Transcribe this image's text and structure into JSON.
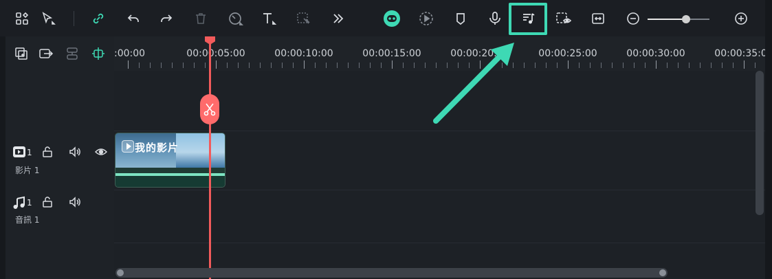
{
  "toolbar": {
    "left_tools": [
      "layout-icon",
      "select-arrow-icon",
      "link-icon",
      "undo-icon",
      "redo-icon",
      "delete-icon",
      "speed-icon",
      "text-icon",
      "crop-icon",
      "more-icon"
    ],
    "center_tools": [
      "ai-bot-icon",
      "render-preview-icon",
      "marker-icon",
      "voiceover-icon",
      "audio-beat-icon",
      "proxy-preview-icon",
      "fit-icon"
    ],
    "highlighted_tool": "audio-beat-icon",
    "zoom_level": 0.62
  },
  "timeline": {
    "ruler_labels": [
      ":00:00",
      "00:00:05:00",
      "00:00:10:00",
      "00:00:15:00",
      "00:00:20:00",
      "00:00:25:00",
      "00:00:30:00",
      "00:00:35:00"
    ],
    "playhead_time": "00:00:04:26"
  },
  "tracks": {
    "video": {
      "number": "1",
      "label": "影片 1"
    },
    "audio": {
      "number": "1",
      "label": "音訊 1"
    }
  },
  "clip": {
    "title": "我的影片"
  },
  "colors": {
    "accent": "#3ed9b4",
    "playhead": "#f25b5b",
    "background": "#1d2126"
  }
}
